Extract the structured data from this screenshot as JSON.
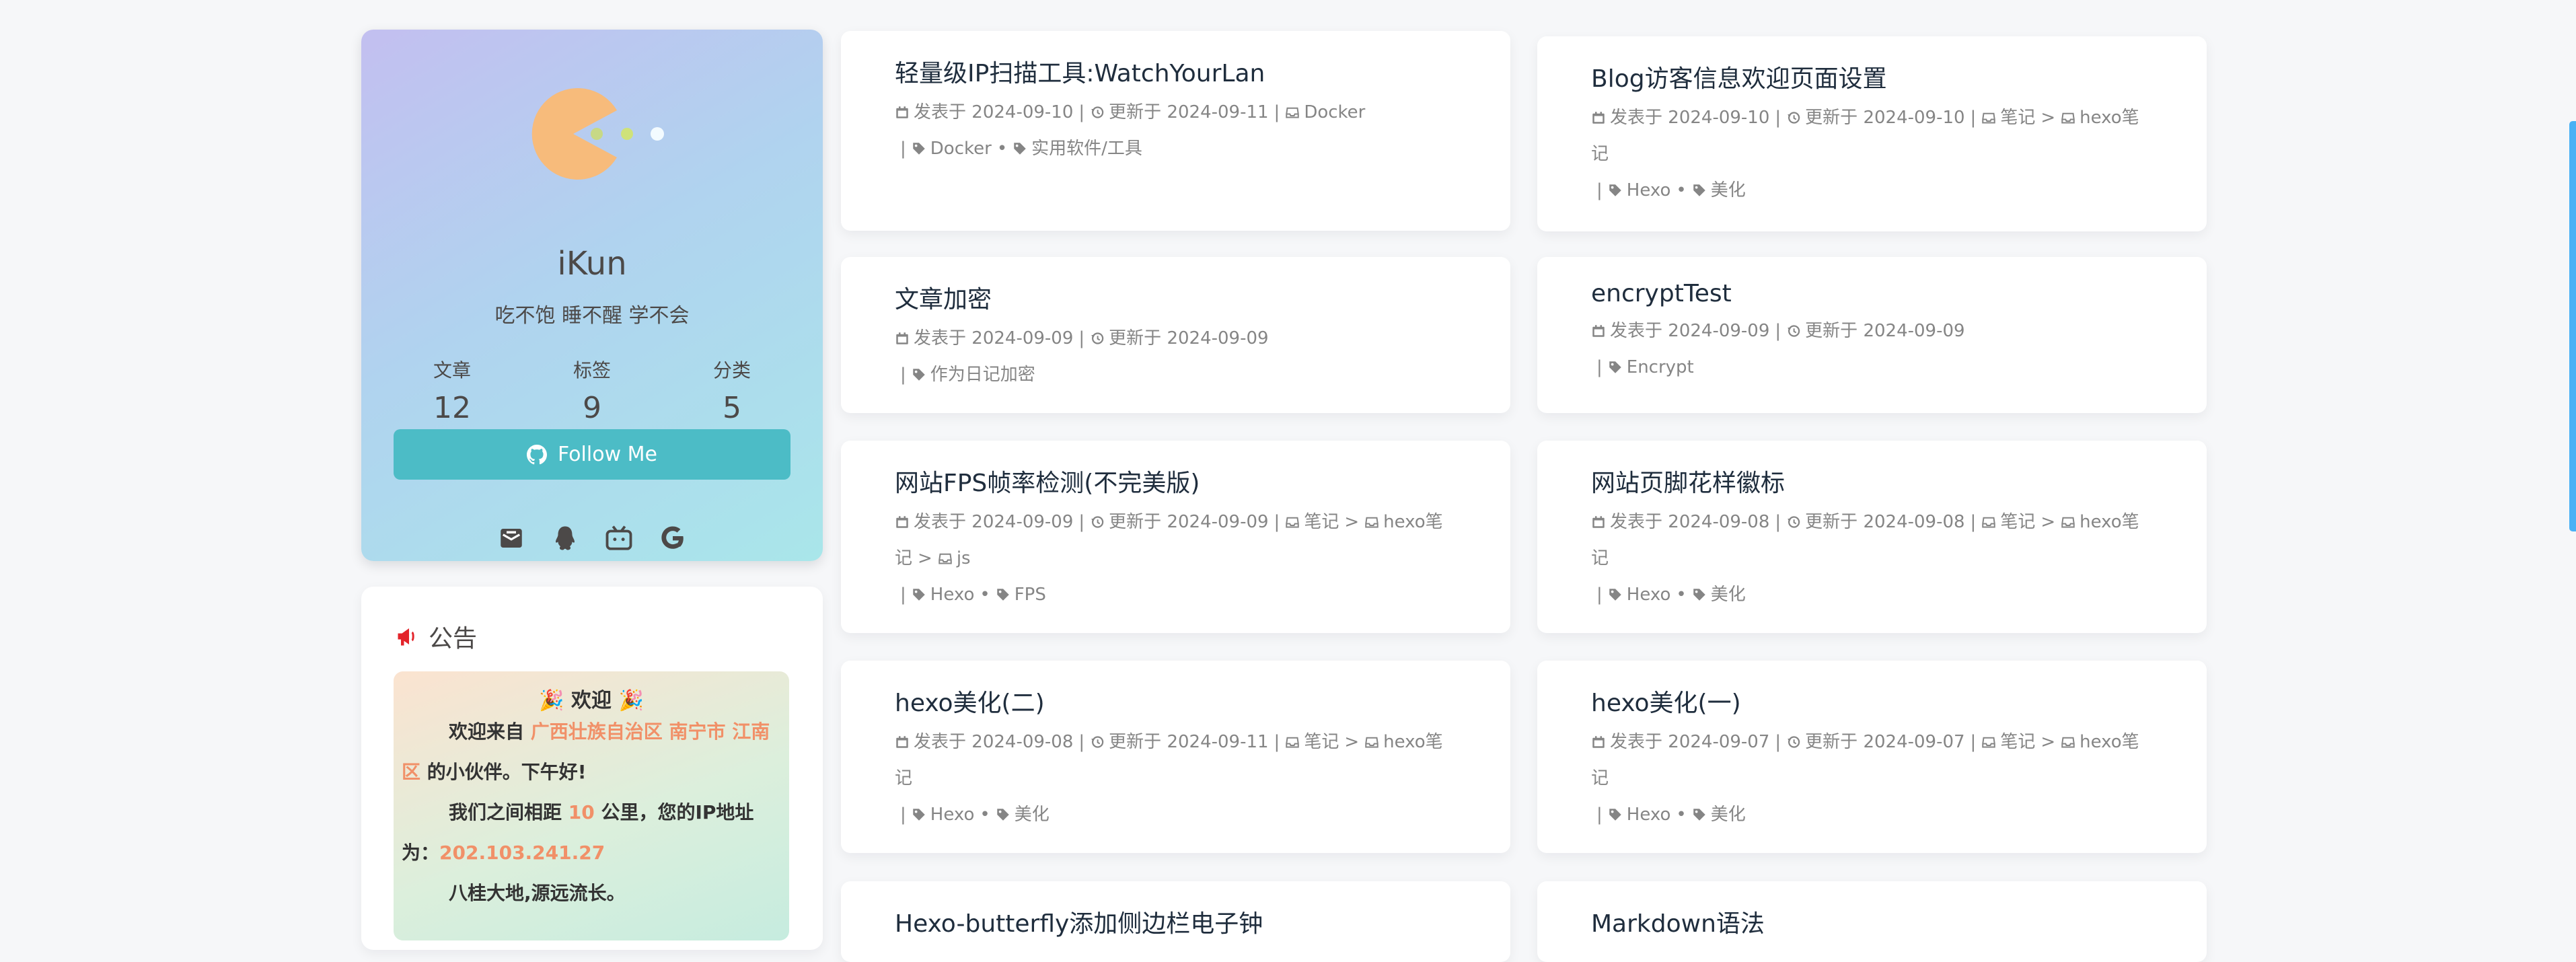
{
  "profile": {
    "name": "iKun",
    "description": "吃不饱 睡不醒 学不会",
    "stats": [
      {
        "label": "文章",
        "value": "12"
      },
      {
        "label": "标签",
        "value": "9"
      },
      {
        "label": "分类",
        "value": "5"
      }
    ],
    "follow_label": "Follow Me",
    "socials": [
      "mail-icon",
      "qq-icon",
      "bilibili-icon",
      "google-icon"
    ]
  },
  "announcement": {
    "title": "公告",
    "welcome": "欢迎",
    "line1_pre": "欢迎来自",
    "location": "广西壮族自治区 南宁市 江南区",
    "line1_post": "的小伙伴。下午好!",
    "line2_pre": "我们之间相距",
    "distance": "10",
    "line2_mid": "公里，您的IP地址为：",
    "ip": "202.103.241.27",
    "line3": "八桂大地,源远流长。"
  },
  "labels": {
    "posted": "发表于",
    "updated": "更新于"
  },
  "articles": [
    {
      "title": "轻量级IP扫描工具:WatchYourLan",
      "posted": "2024-09-10",
      "updated": "2024-09-11",
      "categories": [
        "Docker"
      ],
      "tags": [
        "Docker",
        "实用软件/工具"
      ]
    },
    {
      "title": "Blog访客信息欢迎页面设置",
      "posted": "2024-09-10",
      "updated": "2024-09-10",
      "categories": [
        "笔记",
        "hexo笔记"
      ],
      "tags": [
        "Hexo",
        "美化"
      ]
    },
    {
      "title": "文章加密",
      "posted": "2024-09-09",
      "updated": "2024-09-09",
      "categories": [],
      "tags": [
        "作为日记加密"
      ]
    },
    {
      "title": "encryptTest",
      "posted": "2024-09-09",
      "updated": "2024-09-09",
      "categories": [],
      "tags": [
        "Encrypt"
      ]
    },
    {
      "title": "网站FPS帧率检测(不完美版)",
      "posted": "2024-09-09",
      "updated": "2024-09-09",
      "categories": [
        "笔记",
        "hexo笔记",
        "js"
      ],
      "tags": [
        "Hexo",
        "FPS"
      ]
    },
    {
      "title": "网站页脚花样徽标",
      "posted": "2024-09-08",
      "updated": "2024-09-08",
      "categories": [
        "笔记",
        "hexo笔记"
      ],
      "tags": [
        "Hexo",
        "美化"
      ]
    },
    {
      "title": "hexo美化(二)",
      "posted": "2024-09-08",
      "updated": "2024-09-11",
      "categories": [
        "笔记",
        "hexo笔记"
      ],
      "tags": [
        "Hexo",
        "美化"
      ]
    },
    {
      "title": "hexo美化(一)",
      "posted": "2024-09-07",
      "updated": "2024-09-07",
      "categories": [
        "笔记",
        "hexo笔记"
      ],
      "tags": [
        "Hexo",
        "美化"
      ]
    },
    {
      "title": "Hexo-butterfly添加侧边栏电子钟",
      "posted": "",
      "updated": "",
      "categories": [],
      "tags": []
    },
    {
      "title": "Markdown语法",
      "posted": "",
      "updated": "",
      "categories": [],
      "tags": []
    }
  ]
}
